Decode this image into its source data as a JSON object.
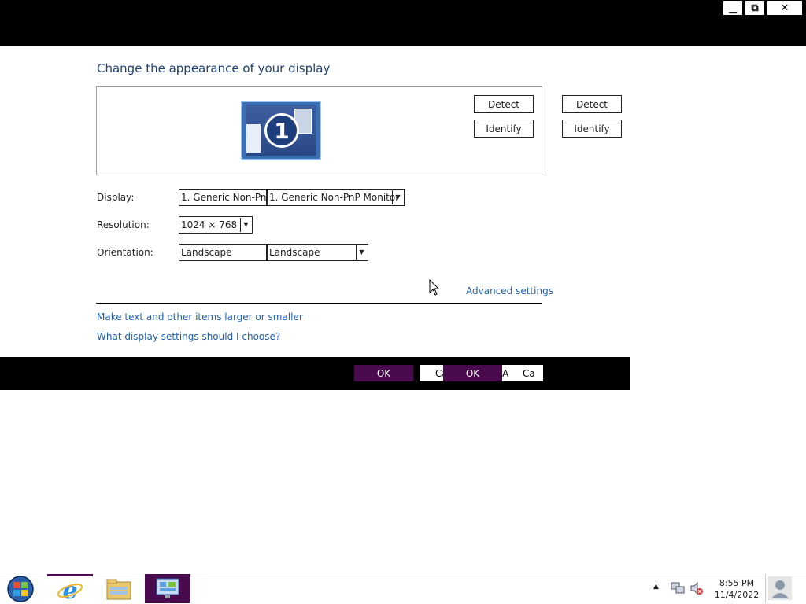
{
  "window": {
    "minimize_glyph": "▁",
    "restore_glyph": "⧉",
    "close_glyph": "✕"
  },
  "heading": "Change the appearance of your display",
  "monitor_number": "1",
  "buttons": {
    "detect": "Detect",
    "identify": "Identify"
  },
  "fields": {
    "display_label": "Display:",
    "display_values": [
      "1. Generic Non-PnP",
      "1. Generic Non-PnP Monitor"
    ],
    "resolution_label": "Resolution:",
    "resolution_value": "1024 × 768",
    "orientation_label": "Orientation:",
    "orientation_values": [
      "Landscape",
      "Landscape"
    ]
  },
  "links": {
    "advanced": "Advanced settings",
    "text_size": "Make text and other items larger or smaller",
    "which_settings": "What display settings should I choose?"
  },
  "dialog_buttons": {
    "ok": "OK",
    "cancel_fragment_1": "Ca",
    "apply_fragment": "A",
    "cancel_fragment_2": "Ca"
  },
  "taskbar": {
    "time": "8:55 PM",
    "date": "11/4/2022"
  },
  "colors": {
    "accent_purple": "#4a0a4e",
    "link_blue": "#2160b0",
    "heading_blue": "#1e3f7a"
  }
}
